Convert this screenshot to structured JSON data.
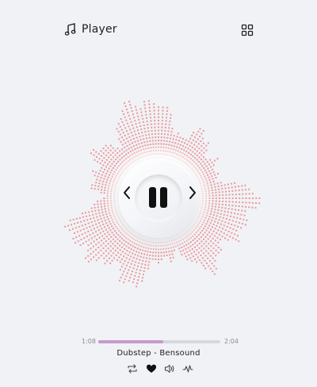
{
  "header": {
    "title": "Player",
    "logo_icon": "music-note-icon",
    "menu_icon": "grid-icon"
  },
  "player": {
    "current_time": "1:08",
    "total_time": "2:04",
    "progress": 0.535,
    "track_title": "Dubstep - Bensound",
    "state": "playing",
    "controls": [
      "previous-icon",
      "pause-icon",
      "next-icon"
    ]
  },
  "bottom_controls": [
    "repeat-icon",
    "heart-icon",
    "volume-icon",
    "waveform-icon"
  ],
  "colors": {
    "background": "#f1f2f6",
    "visualizer_dots": "#e88a8a",
    "progress_fill": "#c79acb",
    "progress_track": "#d7d8de",
    "icon": "#111111"
  }
}
